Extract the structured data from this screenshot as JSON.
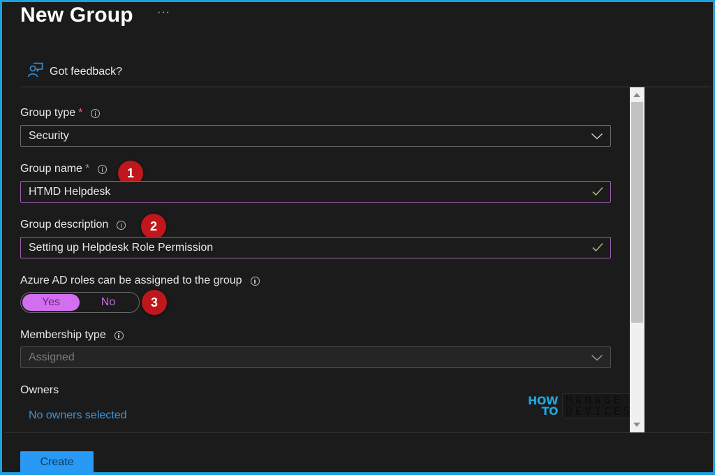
{
  "header": {
    "title": "New Group",
    "more_label": "···",
    "feedback_label": "Got feedback?"
  },
  "form": {
    "group_type": {
      "label": "Group type",
      "required_mark": "*",
      "value": "Security"
    },
    "group_name": {
      "label": "Group name",
      "required_mark": "*",
      "value": "HTMD Helpdesk",
      "badge": "1"
    },
    "group_description": {
      "label": "Group description",
      "value": "Setting up Helpdesk Role Permission",
      "badge": "2"
    },
    "azure_ad_roles": {
      "label": "Azure AD roles can be assigned to the group",
      "options": [
        "Yes",
        "No"
      ],
      "selected": "Yes",
      "badge": "3"
    },
    "membership_type": {
      "label": "Membership type",
      "value": "Assigned"
    },
    "owners": {
      "label": "Owners",
      "link": "No owners selected"
    }
  },
  "footer": {
    "create_label": "Create"
  },
  "watermark": {
    "line1a": "HOW",
    "line1b": "TO",
    "line2a": "MANAGE",
    "line2b": "DEVICES"
  },
  "colors": {
    "accent_frame": "#1ba1e2",
    "primary_button": "#2899f5",
    "toggle_on": "#d36ef0",
    "valid_border": "#a05fb0",
    "link": "#3a96dd",
    "badge": "#c0171d",
    "required": "#f1707b"
  }
}
